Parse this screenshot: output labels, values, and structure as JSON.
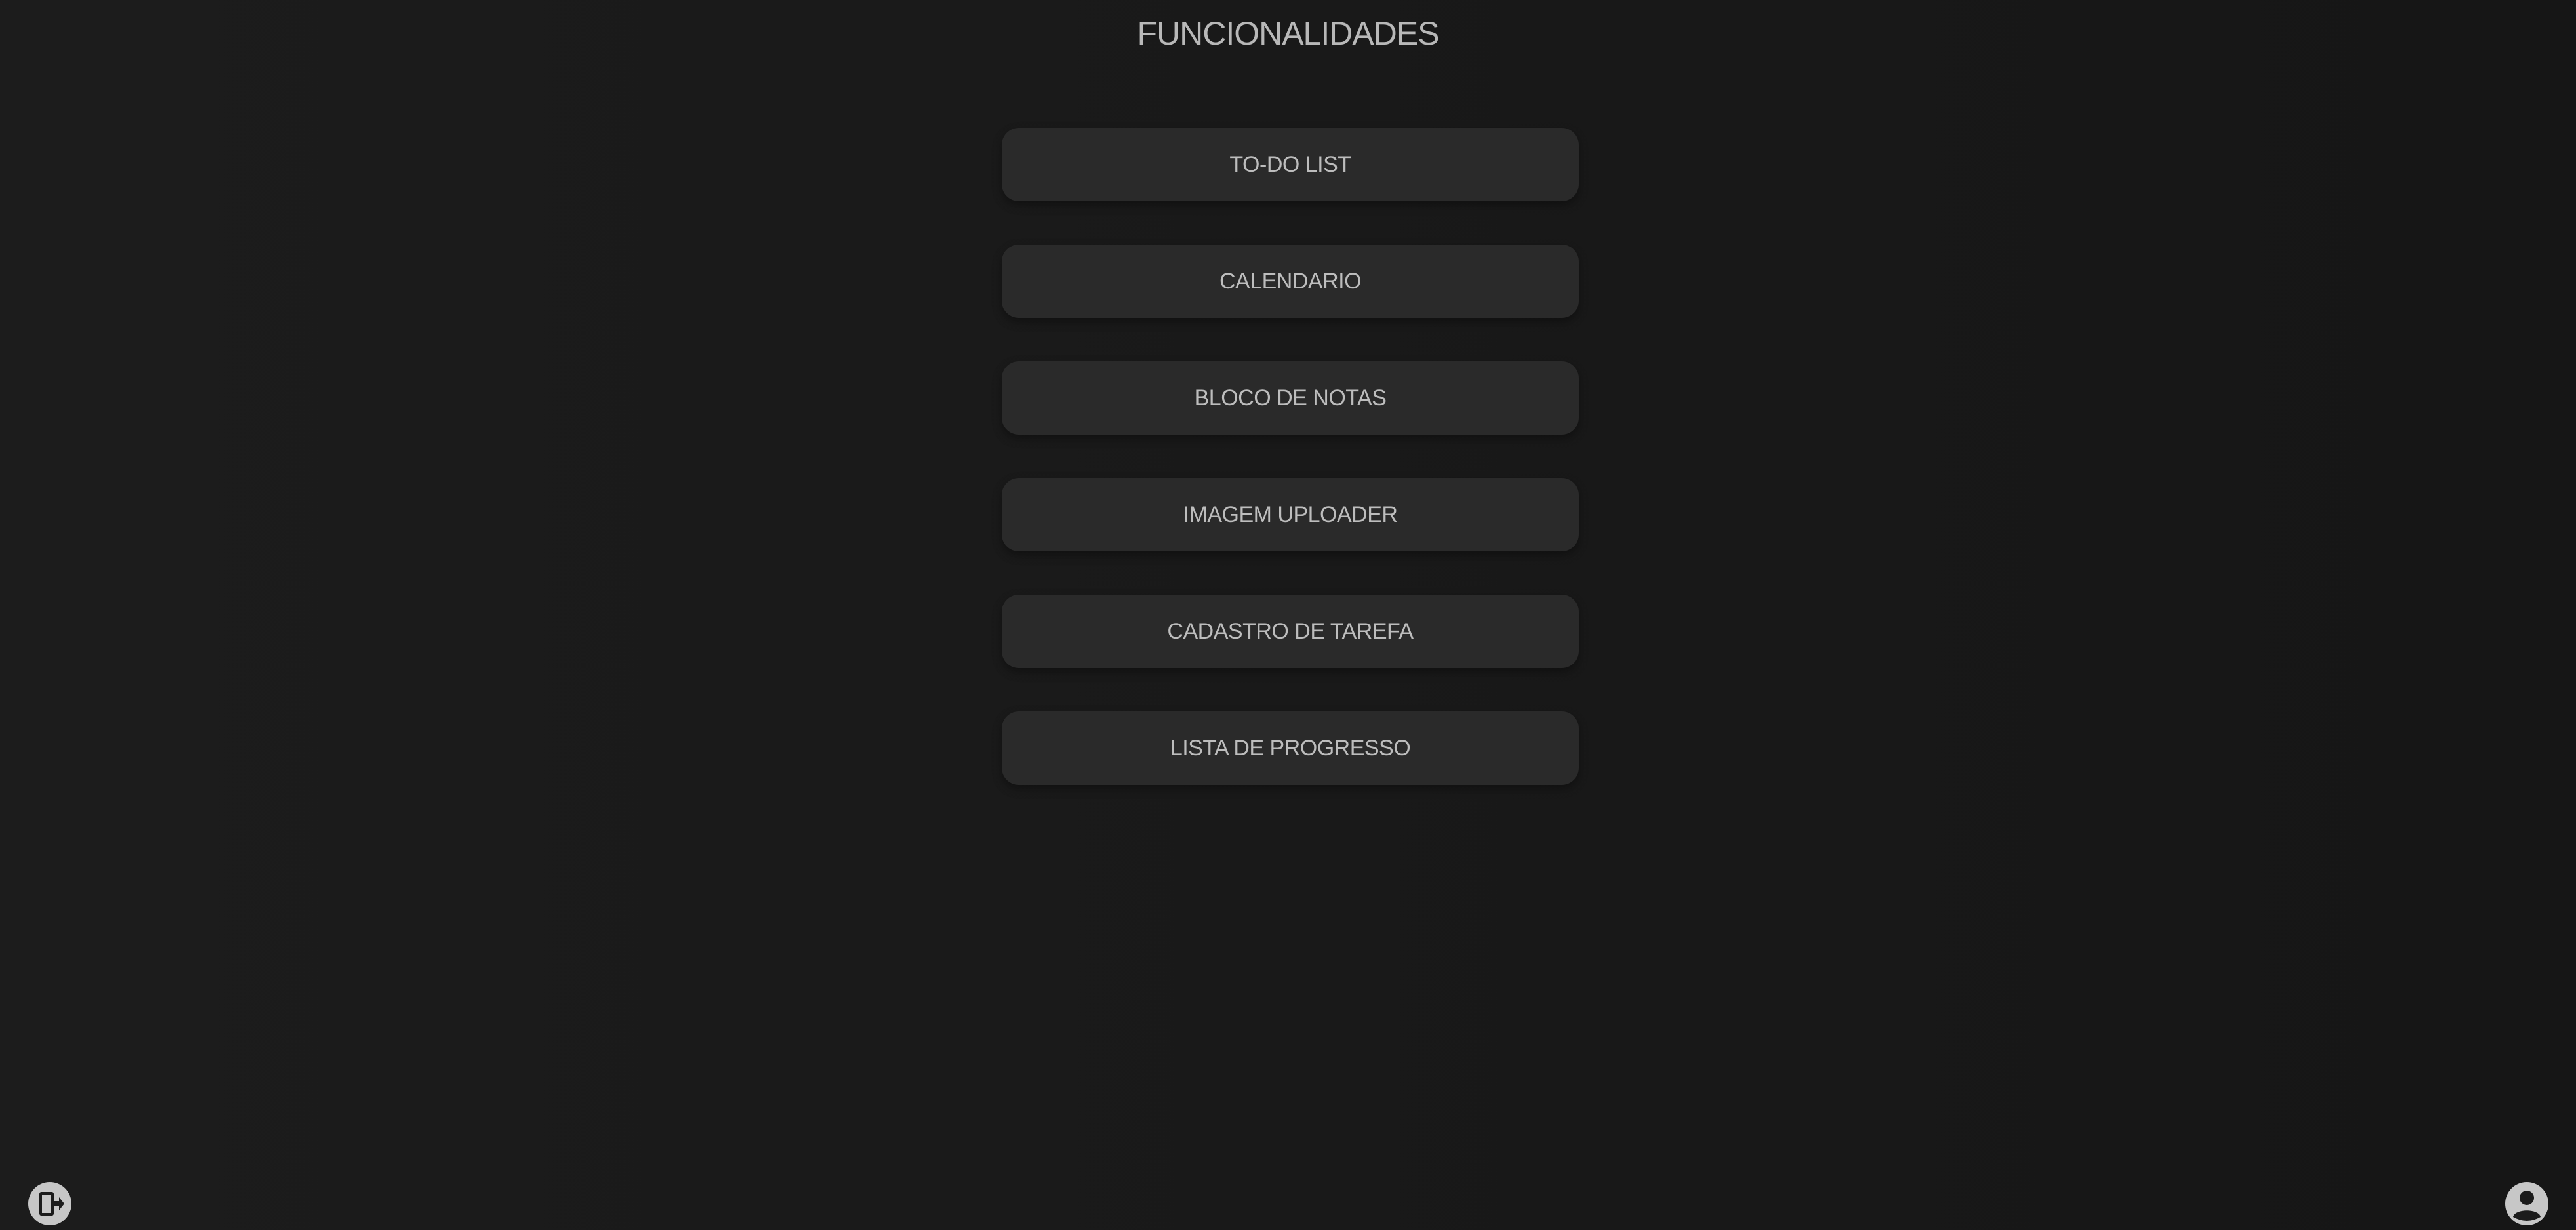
{
  "page": {
    "title": "FUNCIONALIDADES",
    "background_color": "#1b1b1b",
    "button_color": "#2a2a2a",
    "text_color": "#bdbdbd"
  },
  "menu": {
    "items": [
      {
        "label": "TO-DO LIST"
      },
      {
        "label": "CALENDARIO"
      },
      {
        "label": "BLOCO DE NOTAS"
      },
      {
        "label": "IMAGEM UPLOADER"
      },
      {
        "label": "CADASTRO DE TAREFA"
      },
      {
        "label": "LISTA DE PROGRESSO"
      }
    ]
  },
  "footer": {
    "left_icon": "logout-icon",
    "right_icon": "user-profile-icon"
  }
}
